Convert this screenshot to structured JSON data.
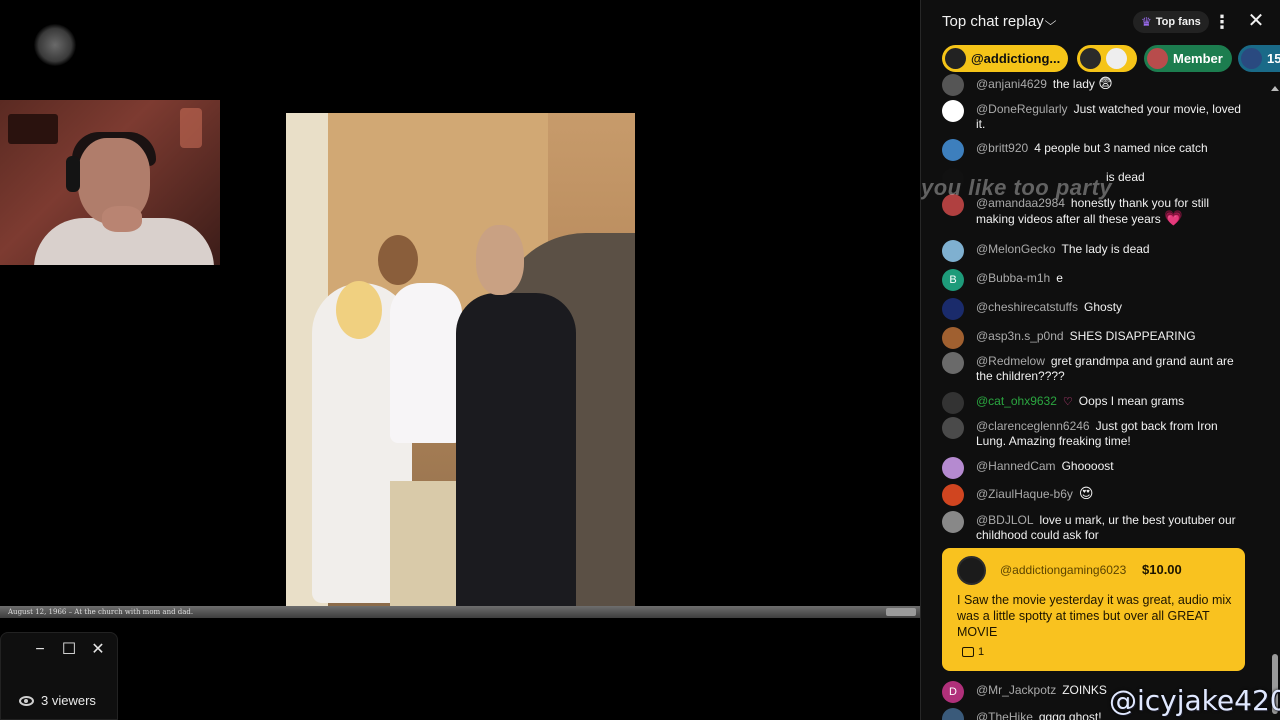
{
  "video": {
    "caption": "August 12, 1966 – At the church with mom and dad.",
    "viewers": "3 viewers"
  },
  "chat": {
    "title": "Top chat replay",
    "top_fans_label": "Top fans",
    "chips": [
      {
        "label": "@addictiong..."
      },
      {
        "label": ""
      },
      {
        "label": "Member"
      },
      {
        "label": "15"
      }
    ],
    "overlay_text": "you like too party",
    "messages": [
      {
        "author": "@anjani4629",
        "text": "the lady",
        "emoji": "😨",
        "avatar_color": "#555"
      },
      {
        "author": "@DoneRegularly",
        "text": "Just watched your movie, loved it.",
        "avatar_color": "#ffffff"
      },
      {
        "author": "@britt920",
        "text": "4 people but 3 named nice catch",
        "avatar_color": "#3d7fbd"
      },
      {
        "author": "",
        "text": "is dead",
        "avatar_color": "#111"
      },
      {
        "author": "@amandaa2984",
        "text": "honestly thank you for still making videos after all these years",
        "avatar_color": "#b04040"
      },
      {
        "author": "@MelonGecko",
        "text": "The lady is dead",
        "avatar_color": "#7fb0d0"
      },
      {
        "author": "@Bubba-m1h",
        "text": "e",
        "avatar_letter": "B",
        "avatar_color": "#1e9b7a"
      },
      {
        "author": "@cheshirecatstuffs",
        "text": "Ghosty",
        "avatar_color": "#1a2b6b"
      },
      {
        "author": "@asp3n.s_p0nd",
        "text": "SHES DISAPPEARING",
        "avatar_color": "#a06030"
      },
      {
        "author": "@Redmelow",
        "text": "gret grandmpa and grand aunt are the children????",
        "avatar_color": "#6a6a6a"
      },
      {
        "author": "@cat_ohx9632",
        "text": "Oops I mean grams",
        "avatar_color": "#333"
      },
      {
        "author": "@clarenceglenn6246",
        "text": "Just got back from Iron Lung. Amazing freaking time!",
        "avatar_color": "#4a4a4a"
      },
      {
        "author": "@HannedCam",
        "text": "Ghoooost",
        "avatar_color": "#b58ad0"
      },
      {
        "author": "@ZiaulHaque-b6y",
        "text": "",
        "emoji": "😍",
        "avatar_color": "#d04520"
      },
      {
        "author": "@BDJLOL",
        "text": "love u mark, ur the best youtuber our childhood could ask for",
        "avatar_color": "#888"
      },
      {
        "author": "@Mr_Jackpotz",
        "text": "ZOINKS",
        "avatar_letter": "D",
        "avatar_color": "#b0307a"
      },
      {
        "author": "@TheHike",
        "text": "gggg ghost!",
        "avatar_color": "#3a5a7a"
      }
    ],
    "superchat": {
      "author": "@addictiongaming6023",
      "amount": "$10.00",
      "text": "I Saw the movie yesterday it was great, audio mix was a little spotty at times but over all GREAT MOVIE",
      "replies": "1"
    }
  },
  "watermark": "@icyjake420",
  "colors": {
    "superchat_bg": "#f9c21f",
    "member_chip": "#1c7d4f",
    "green_author": "#2ba640"
  }
}
